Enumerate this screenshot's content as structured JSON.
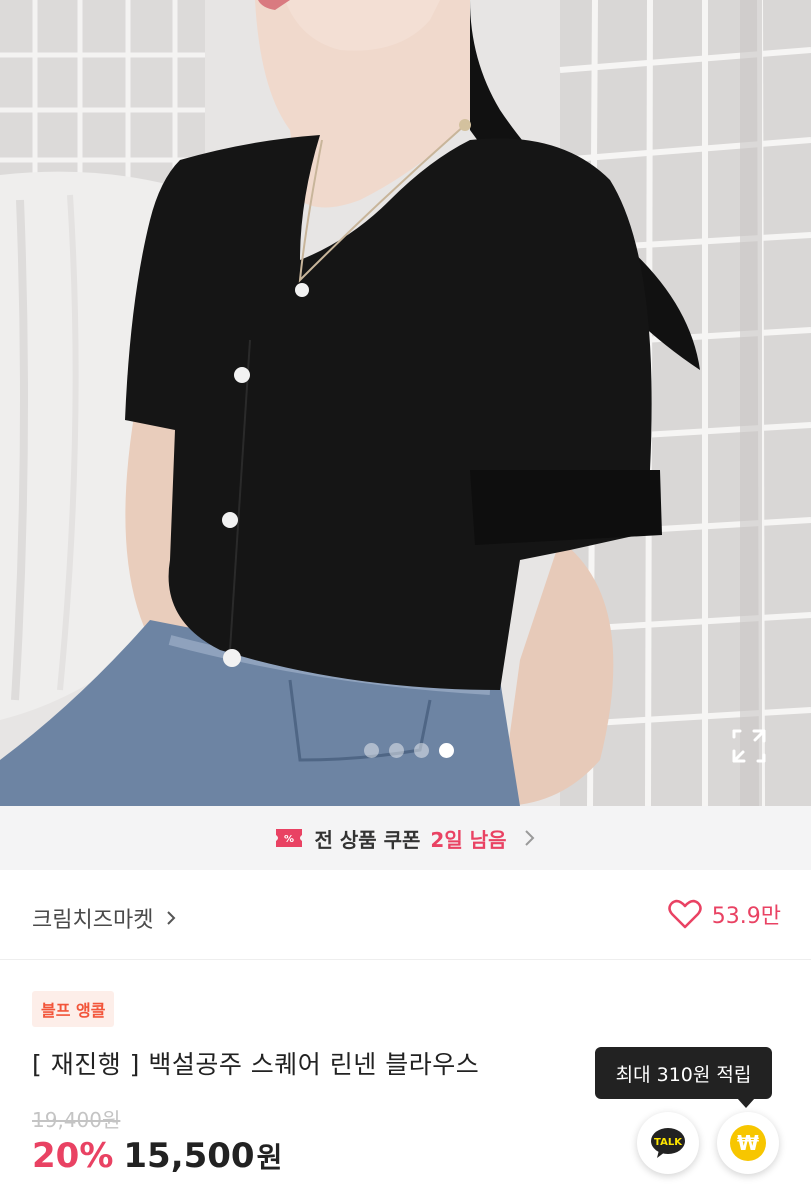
{
  "gallery": {
    "slide_count": 4,
    "active_slide": 4
  },
  "coupon_banner": {
    "text": "전 상품 쿠폰",
    "remaining": "2일 남음",
    "icon": "coupon-icon",
    "accent_color": "#e94263"
  },
  "store": {
    "name": "크림치즈마켓",
    "likes": "53.9만"
  },
  "product": {
    "badge": "블프 앵콜",
    "title": "[ 재진행 ] 백설공주 스퀘어 린넨 블라우스",
    "original_price": "19,400원",
    "discount": "20%",
    "price": "15,500",
    "price_unit": "원"
  },
  "floating": {
    "tooltip": "최대 310원 적립",
    "talk_label": "TALK",
    "point_symbol": "₩"
  }
}
